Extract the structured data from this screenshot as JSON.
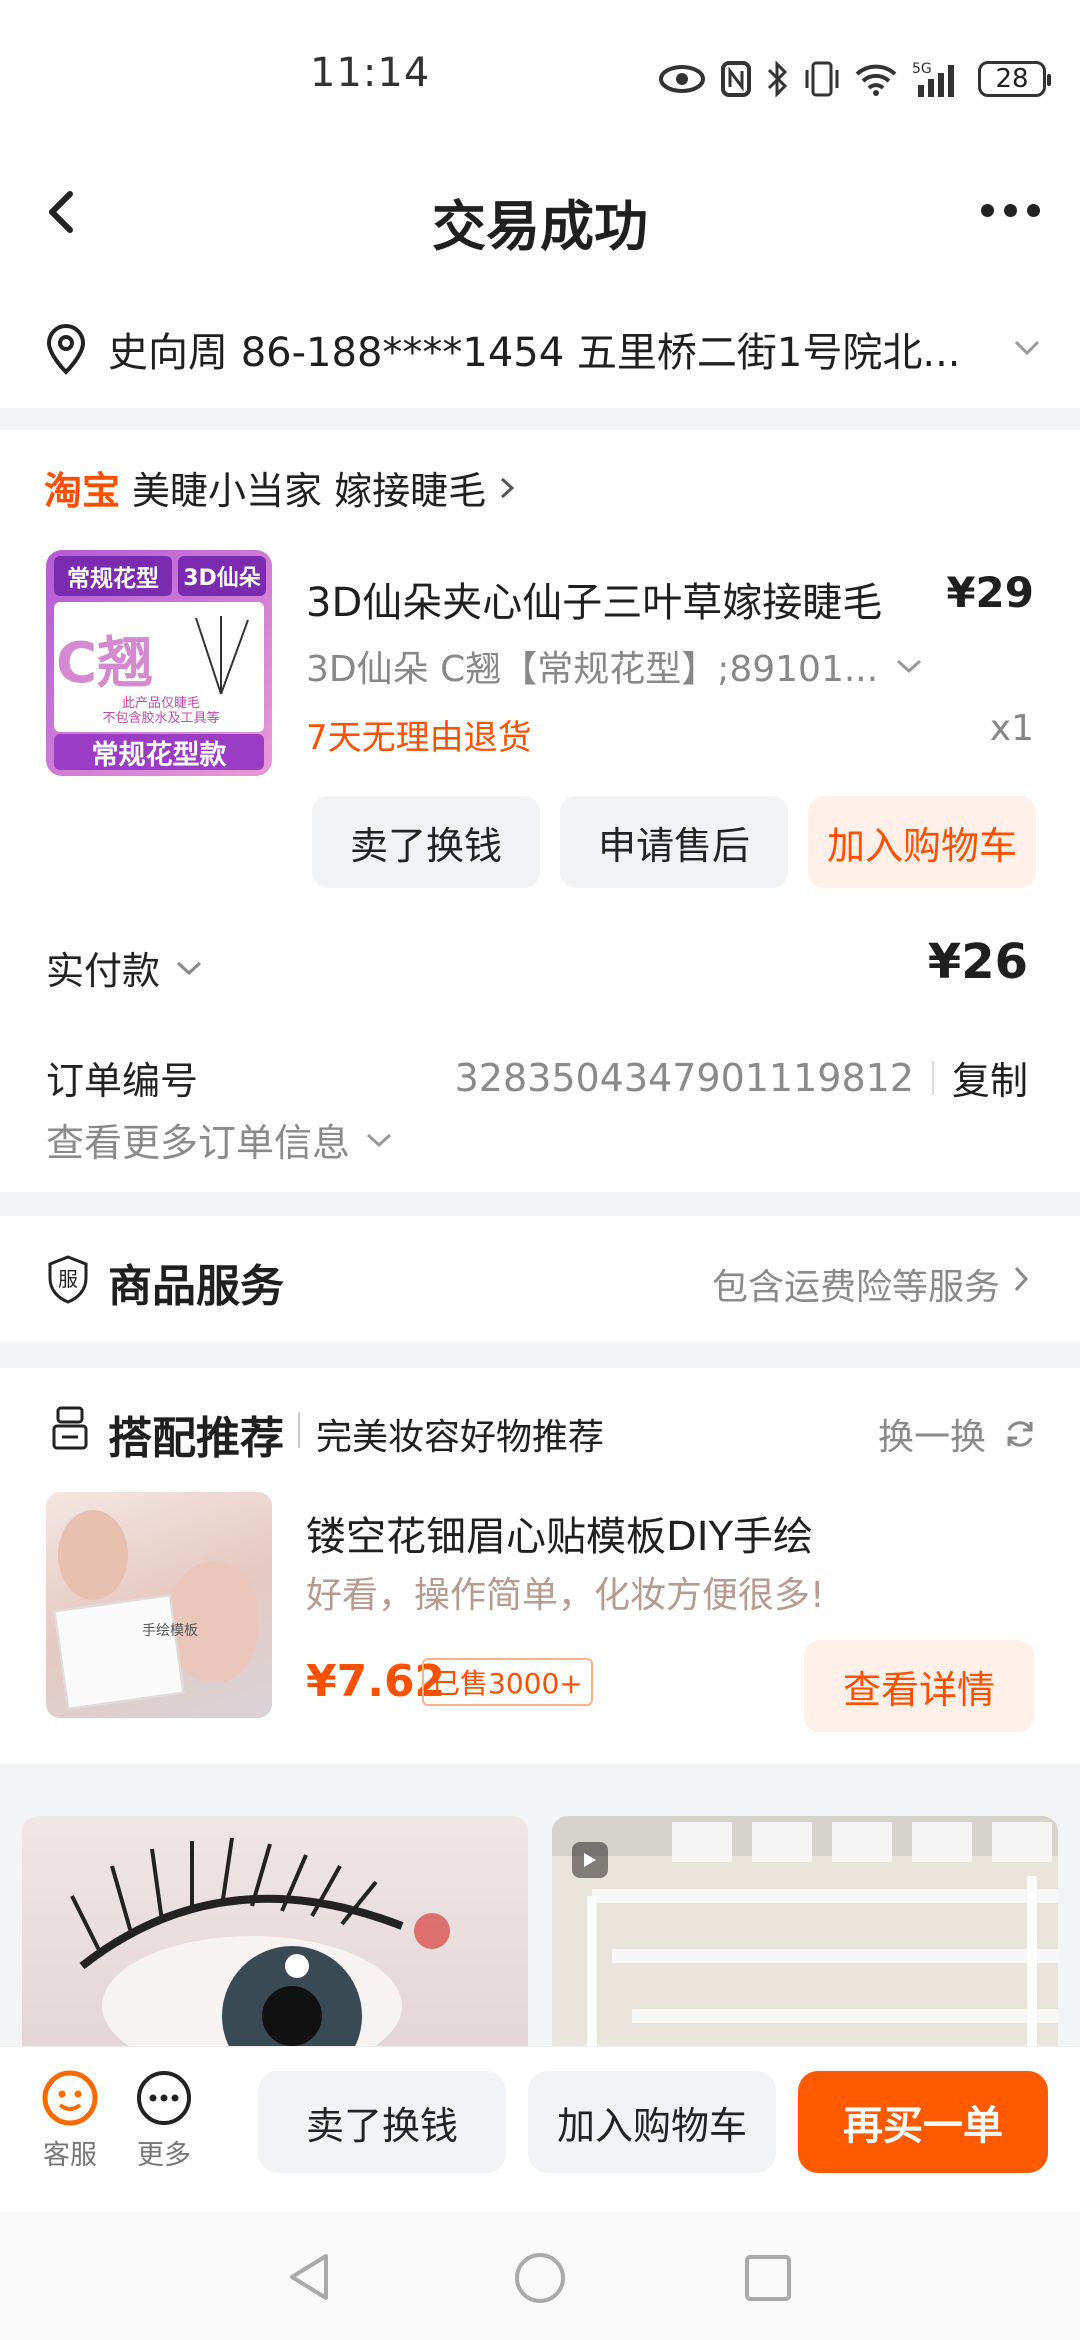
{
  "status": {
    "time": "11:14",
    "battery": "28"
  },
  "nav": {
    "title": "交易成功"
  },
  "address": {
    "text": "史向周  86-188****1454  五里桥二街1号院北..."
  },
  "store": {
    "brand": "淘宝",
    "name": "美睫小当家 嫁接睫毛"
  },
  "product": {
    "title": "3D仙朵夹心仙子三叶草嫁接睫毛",
    "price": "¥29",
    "sku": "3D仙朵 C翘【常规花型】;89101...",
    "return_policy": "7天无理由退货",
    "qty": "x1",
    "thumb_top_left": "常规花型",
    "thumb_top_right": "3D仙朵",
    "thumb_center": "C翘",
    "thumb_note": "此产品仅睫毛\n不包含胶水及工具等",
    "thumb_bottom": "常规花型款"
  },
  "product_actions": {
    "sell": "卖了换钱",
    "after_sales": "申请售后",
    "add_cart": "加入购物车"
  },
  "payment": {
    "label": "实付款",
    "amount": "¥26"
  },
  "order": {
    "label": "订单编号",
    "number": "3283504347901119812",
    "copy": "复制",
    "more_info": "查看更多订单信息"
  },
  "service": {
    "icon_label": "服",
    "title": "商品服务",
    "desc": "包含运费险等服务"
  },
  "recommend": {
    "title": "搭配推荐",
    "subtitle": "完美妆容好物推荐",
    "refresh": "换一换",
    "item_title": "镂空花钿眉心贴模板DIY手绘",
    "item_desc": "好看，操作简单，化妆方便很多!",
    "item_price": "¥7.62",
    "item_sold": "已售3000+",
    "item_button": "查看详情",
    "thumb_caption": "手绘模板"
  },
  "bottom": {
    "service_label": "客服",
    "more_label": "更多",
    "sell": "卖了换钱",
    "add_cart": "加入购物车",
    "rebuy": "再买一单"
  },
  "colors": {
    "accent": "#ff5a00",
    "taobao": "#ff5000",
    "muted": "#8a8a8a",
    "button_bg": "#f2f3f5"
  }
}
